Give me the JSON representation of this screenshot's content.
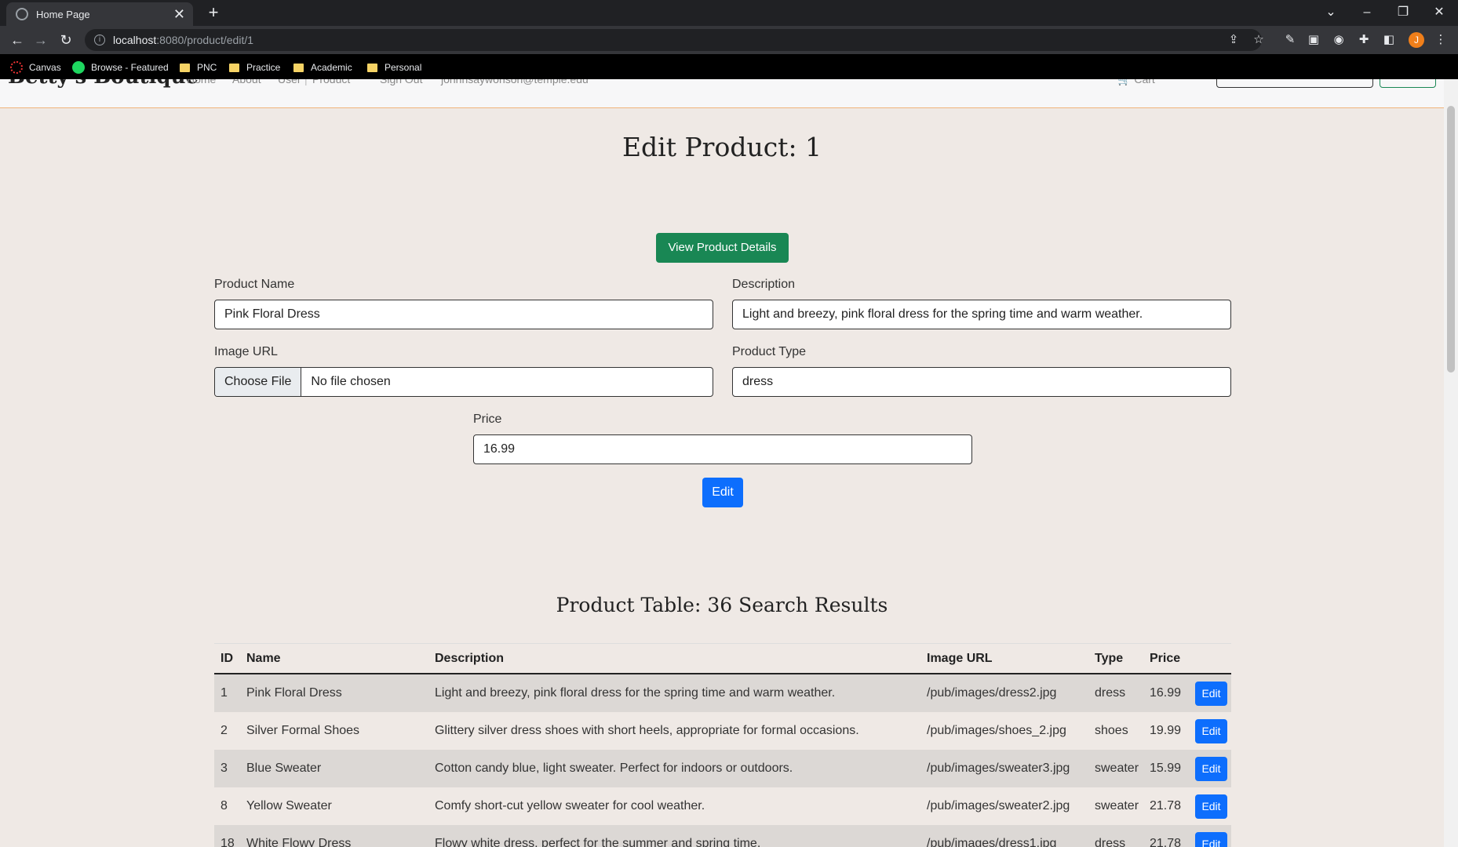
{
  "browser": {
    "tab_title": "Home Page",
    "tab_close": "✕",
    "new_tab": "+",
    "url_host": "localhost",
    "url_path": ":8080/product/edit/1",
    "avatar_letter": "J",
    "bookmarks": [
      {
        "label": "Canvas",
        "icon": "canvas-icon"
      },
      {
        "label": "Browse - Featured",
        "icon": "spotify-icon"
      },
      {
        "label": "PNC",
        "icon": "folder-icon"
      },
      {
        "label": "Practice",
        "icon": "folder-icon"
      },
      {
        "label": "Academic",
        "icon": "folder-icon"
      },
      {
        "label": "Personal",
        "icon": "folder-icon"
      }
    ]
  },
  "site": {
    "brand": "Betty's Boutique",
    "nav": [
      "Home",
      "About",
      "User",
      "Product",
      "Sign Out",
      "johnnsaywonson@temple.edu"
    ],
    "cart": "Cart"
  },
  "edit": {
    "title": "Edit Product: 1",
    "view_details_button": "View Product Details",
    "product_name_label": "Product Name",
    "product_name_value": "Pink Floral Dress",
    "description_label": "Description",
    "description_value": "Light and breezy, pink floral dress for the spring time and warm weather.",
    "image_url_label": "Image URL",
    "choose_file_button": "Choose File",
    "no_file_text": "No file chosen",
    "product_type_label": "Product Type",
    "product_type_value": "dress",
    "price_label": "Price",
    "price_value": "16.99",
    "edit_button": "Edit"
  },
  "table": {
    "title": "Product Table: 36 Search Results",
    "headers": [
      "ID",
      "Name",
      "Description",
      "Image URL",
      "Type",
      "Price"
    ],
    "rows": [
      {
        "id": "1",
        "name": "Pink Floral Dress",
        "description": "Light and breezy, pink floral dress for the spring time and warm weather.",
        "image": "/pub/images/dress2.jpg",
        "type": "dress",
        "price": "16.99",
        "action": "Edit"
      },
      {
        "id": "2",
        "name": "Silver Formal Shoes",
        "description": "Glittery silver dress shoes with short heels, appropriate for formal occasions.",
        "image": "/pub/images/shoes_2.jpg",
        "type": "shoes",
        "price": "19.99",
        "action": "Edit"
      },
      {
        "id": "3",
        "name": "Blue Sweater",
        "description": "Cotton candy blue, light sweater. Perfect for indoors or outdoors.",
        "image": "/pub/images/sweater3.jpg",
        "type": "sweater",
        "price": "15.99",
        "action": "Edit"
      },
      {
        "id": "8",
        "name": "Yellow Sweater",
        "description": "Comfy short-cut yellow sweater for cool weather.",
        "image": "/pub/images/sweater2.jpg",
        "type": "sweater",
        "price": "21.78",
        "action": "Edit"
      },
      {
        "id": "18",
        "name": "White Flowy Dress",
        "description": "Flowy white dress, perfect for the summer and spring time.",
        "image": "/pub/images/dress1.jpg",
        "type": "dress",
        "price": "21.78",
        "action": "Edit"
      }
    ]
  }
}
